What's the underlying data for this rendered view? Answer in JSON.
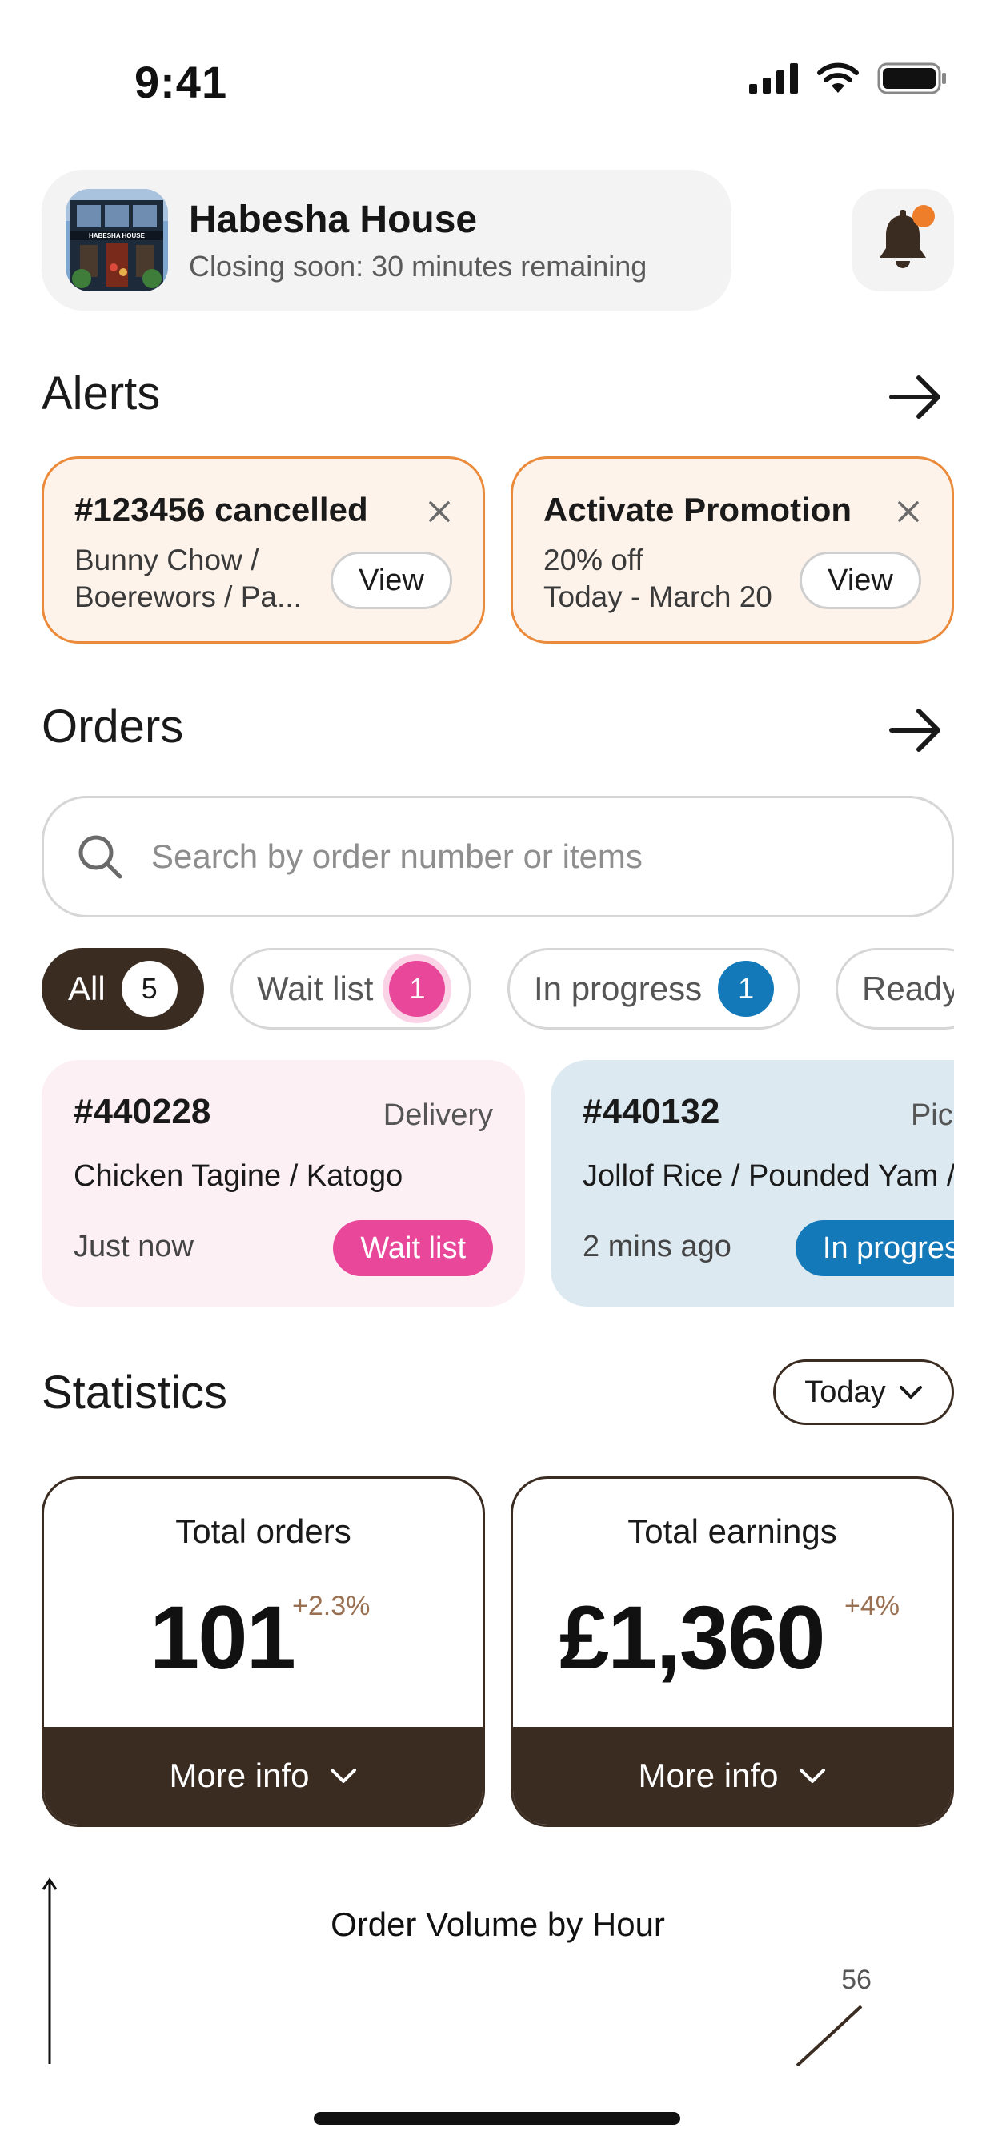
{
  "status_bar": {
    "time": "9:41"
  },
  "header": {
    "store_name": "Habesha House",
    "store_status": "Closing soon: 30 minutes remaining",
    "store_sign": "HABESHA HOUSE",
    "notification_dot_color": "#ef7e2a"
  },
  "alerts": {
    "title": "Alerts",
    "items": [
      {
        "title": "#123456 cancelled",
        "line1": "Bunny Chow /",
        "line2": "Boerewors / Pa...",
        "action": "View"
      },
      {
        "title": "Activate Promotion",
        "line1": "20% off",
        "line2": "Today - March 20",
        "action": "View"
      }
    ]
  },
  "orders": {
    "title": "Orders",
    "search_placeholder": "Search by order number or items",
    "filters": [
      {
        "label": "All",
        "count": "5",
        "active": true
      },
      {
        "label": "Wait list",
        "count": "1",
        "color": "#e8479a"
      },
      {
        "label": "In progress",
        "count": "1",
        "color": "#1479b8"
      },
      {
        "label": "Ready",
        "count": ""
      }
    ],
    "cards": [
      {
        "number": "#440228",
        "type": "Delivery",
        "items": "Chicken Tagine / Katogo",
        "time": "Just now",
        "status": "Wait list",
        "bg": "#fdf0f5",
        "status_color": "#e8479a"
      },
      {
        "number": "#440132",
        "type": "Pickup",
        "items": "Jollof Rice / Pounded Yam / Egusi",
        "time": "2 mins ago",
        "status": "In progress",
        "bg": "#dce9f1",
        "status_color": "#1479b8"
      }
    ]
  },
  "statistics": {
    "title": "Statistics",
    "period": "Today",
    "cards": [
      {
        "label": "Total orders",
        "value": "101",
        "delta": "+2.3%",
        "more": "More info"
      },
      {
        "label": "Total earnings",
        "value": "£1,360",
        "delta": "+4%",
        "more": "More info"
      }
    ]
  },
  "chart_data": {
    "type": "line",
    "title": "Order Volume by Hour",
    "points": [
      {
        "label": "56",
        "value": 56
      }
    ]
  }
}
